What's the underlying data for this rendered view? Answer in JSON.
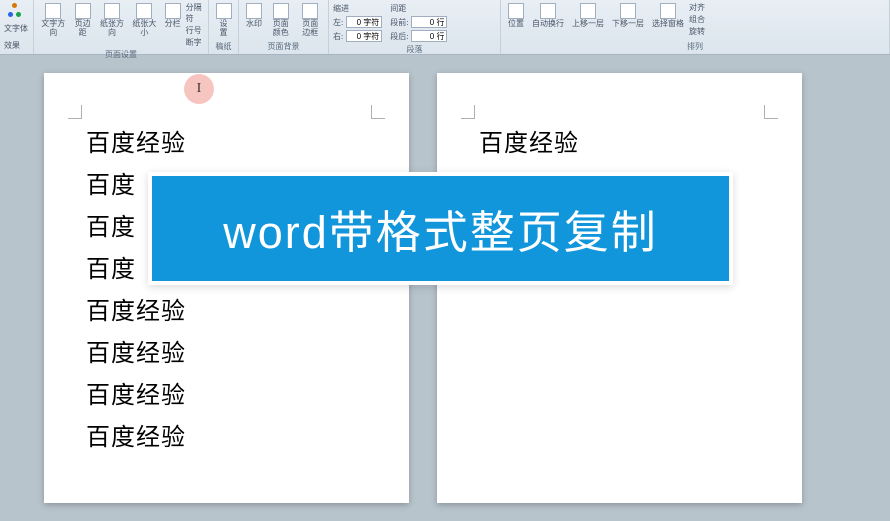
{
  "ribbon": {
    "group_theme": {
      "theme": "主题",
      "font": "文字体",
      "effects": "效果",
      "label": ""
    },
    "group_page_setup": {
      "text_direction": "文字方向",
      "margins": "页边距",
      "orientation": "纸张方向",
      "size": "纸张大小",
      "columns": "分栏",
      "breaks": "分隔符",
      "line_numbers": "行号",
      "hyphenation": "断字",
      "label": "页面设置"
    },
    "group_manuscript": {
      "manuscript": "稿纸",
      "settings": "设置",
      "label": "稿纸"
    },
    "group_page_bg": {
      "watermark": "水印",
      "page_color": "页面颜色",
      "page_border": "页面边框",
      "label": "页面背景"
    },
    "group_paragraph": {
      "indent_label": "缩进",
      "indent_left": "0 字符",
      "indent_right": "0 字符",
      "spacing_label": "间距",
      "spacing_before": "0 行",
      "spacing_after": "0 行",
      "label": "段落"
    },
    "group_arrange": {
      "position": "位置",
      "wrap": "自动换行",
      "bring_forward": "上移一层",
      "send_backward": "下移一层",
      "selection_pane": "选择窗格",
      "align": "对齐",
      "group": "组合",
      "rotate": "旋转",
      "label": "排列"
    }
  },
  "page1_lines": [
    "百度经验",
    "百度",
    "百度",
    "百度",
    "百度经验",
    "百度经验",
    "百度经验",
    "百度经验"
  ],
  "page2_lines": [
    "百度经验"
  ],
  "overlay_text": "word带格式整页复制"
}
